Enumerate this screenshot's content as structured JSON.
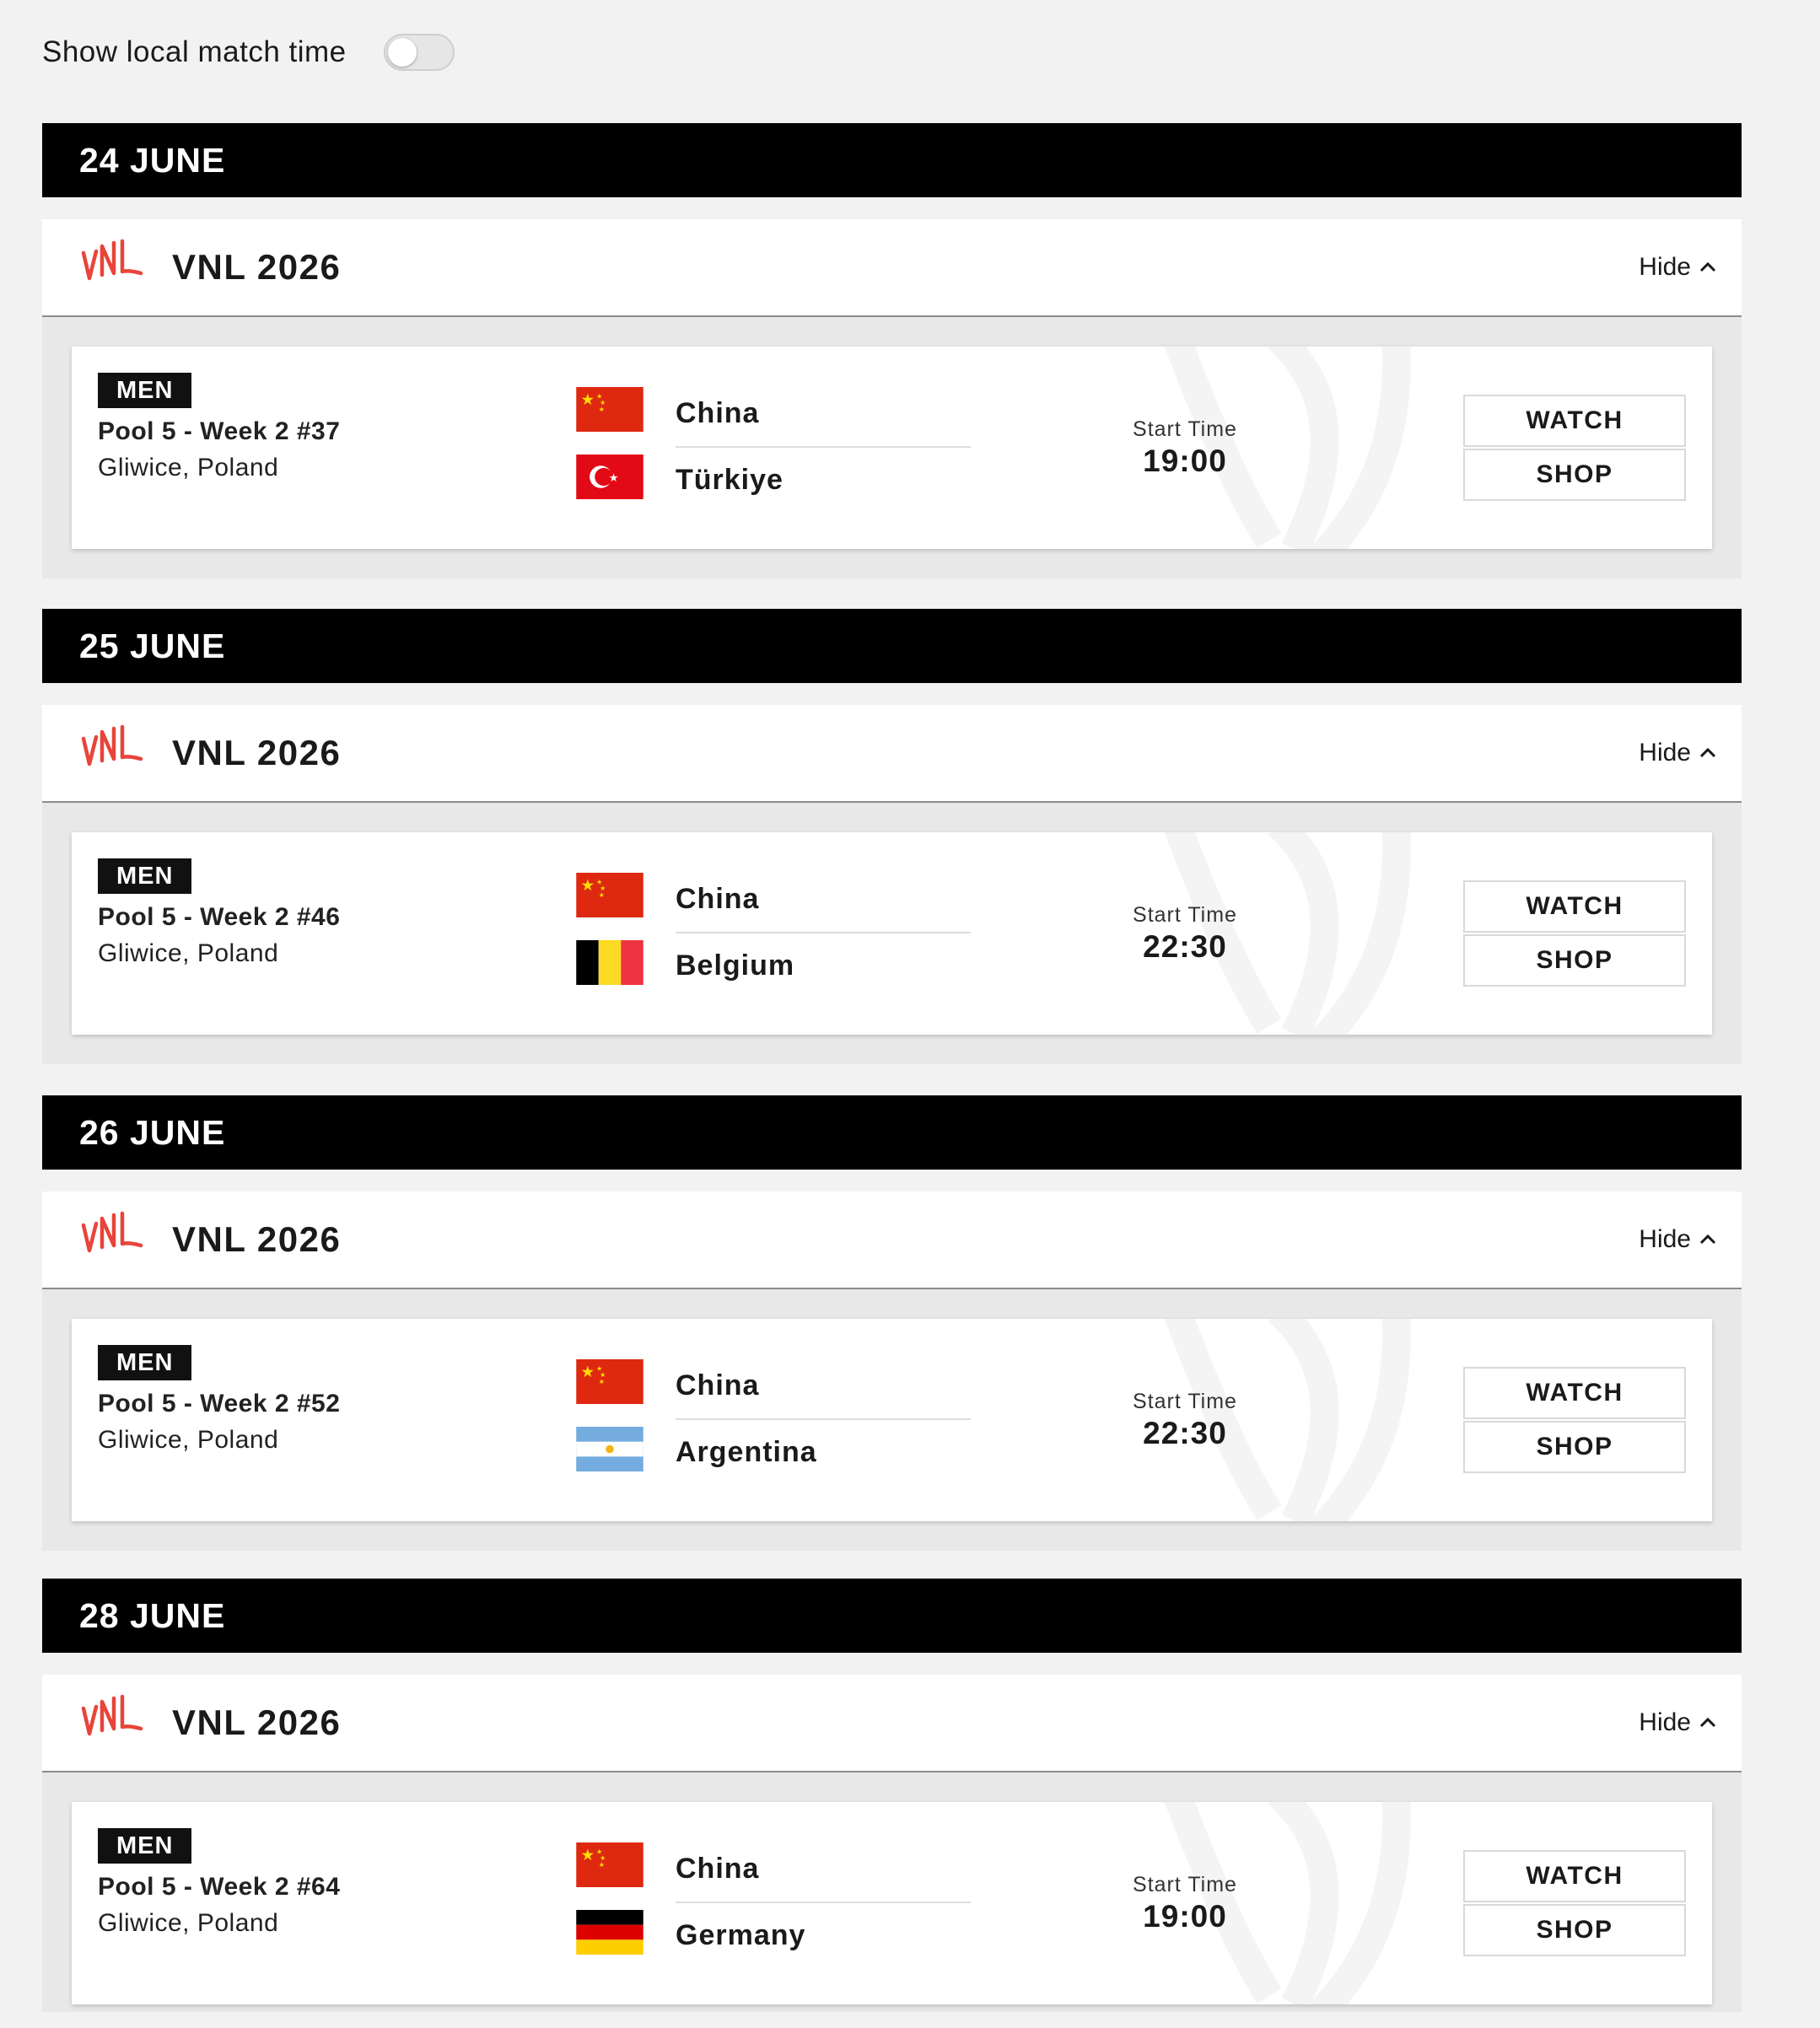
{
  "settings": {
    "toggle_label": "Show local match time",
    "toggle_on": false
  },
  "colors": {
    "accent": "#e8443a",
    "date_bar": "#000000",
    "page_bg": "#f2f2f2"
  },
  "days": [
    {
      "date": "24 JUNE",
      "competition": "VNL 2026",
      "hide_label": "Hide",
      "match": {
        "gender": "MEN",
        "pool": "Pool 5 - Week 2 #37",
        "venue": "Gliwice, Poland",
        "home": "China",
        "home_flag": "china-flag",
        "away": "Türkiye",
        "away_flag": "turkiye-flag",
        "start_label": "Start Time",
        "start_time": "19:00",
        "watch_label": "WATCH",
        "shop_label": "SHOP"
      }
    },
    {
      "date": "25 JUNE",
      "competition": "VNL 2026",
      "hide_label": "Hide",
      "match": {
        "gender": "MEN",
        "pool": "Pool 5 - Week 2 #46",
        "venue": "Gliwice, Poland",
        "home": "China",
        "home_flag": "china-flag",
        "away": "Belgium",
        "away_flag": "belgium-flag",
        "start_label": "Start Time",
        "start_time": "22:30",
        "watch_label": "WATCH",
        "shop_label": "SHOP"
      }
    },
    {
      "date": "26 JUNE",
      "competition": "VNL 2026",
      "hide_label": "Hide",
      "match": {
        "gender": "MEN",
        "pool": "Pool 5 - Week 2 #52",
        "venue": "Gliwice, Poland",
        "home": "China",
        "home_flag": "china-flag",
        "away": "Argentina",
        "away_flag": "argentina-flag",
        "start_label": "Start Time",
        "start_time": "22:30",
        "watch_label": "WATCH",
        "shop_label": "SHOP"
      }
    },
    {
      "date": "28 JUNE",
      "competition": "VNL 2026",
      "hide_label": "Hide",
      "match": {
        "gender": "MEN",
        "pool": "Pool 5 - Week 2 #64",
        "venue": "Gliwice, Poland",
        "home": "China",
        "home_flag": "china-flag",
        "away": "Germany",
        "away_flag": "germany-flag",
        "start_label": "Start Time",
        "start_time": "19:00",
        "watch_label": "WATCH",
        "shop_label": "SHOP"
      }
    }
  ]
}
